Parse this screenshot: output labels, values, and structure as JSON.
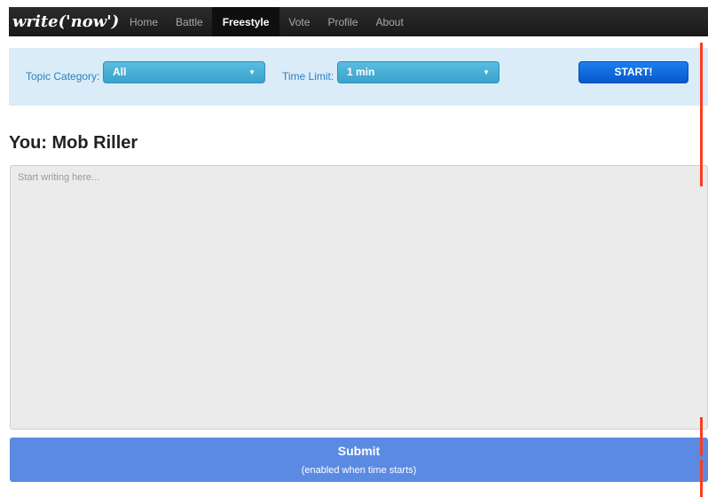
{
  "brand": {
    "prefix": "write",
    "suffix": "('now')"
  },
  "nav": {
    "items": [
      {
        "label": "Home"
      },
      {
        "label": "Battle"
      },
      {
        "label": "Freestyle",
        "active": true
      },
      {
        "label": "Vote"
      },
      {
        "label": "Profile"
      },
      {
        "label": "About"
      }
    ]
  },
  "settings": {
    "topic_label": "Topic Category:",
    "topic_value": "All",
    "time_label": "Time Limit:",
    "time_value": "1 min",
    "start_label": "START!"
  },
  "player": {
    "title": "You: Mob Riller"
  },
  "editor": {
    "placeholder": "Start writing here...",
    "value": ""
  },
  "submit": {
    "label": "Submit",
    "note": "(enabled when time starts)"
  },
  "colors": {
    "navbar": "#1f1f1f",
    "settings_bg": "#d9ecf8",
    "select_bg": "#44abd6",
    "start_bg": "#0f6be0",
    "editor_bg": "#ebebeb",
    "submit_bg": "#5b8ae3",
    "marker": "#ff3b1f"
  }
}
